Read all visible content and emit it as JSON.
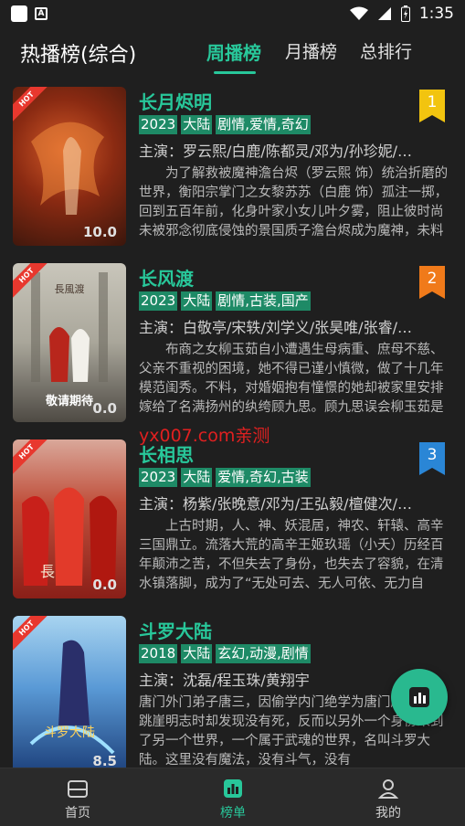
{
  "status_bar": {
    "time": "1:35"
  },
  "header": {
    "title": "热播榜(综合)",
    "tabs": [
      "周播榜",
      "月播榜",
      "总排行"
    ],
    "active_tab": "周播榜"
  },
  "hot_label": "HOT",
  "items": [
    {
      "title": "长月烬明",
      "tags": [
        "2023",
        "大陆",
        "剧情,爱情,奇幻"
      ],
      "cast": "主演：罗云熙/白鹿/陈都灵/邓为/孙珍妮/…",
      "description": "为了解救被魔神澹台烬（罗云熙 饰）统治折磨的世界，衡阳宗掌门之女黎苏苏（白鹿 饰）孤注一掷，回到五百年前，化身叶家小女儿叶夕雾，阻止彼时尚未被邪念彻底侵蚀的景国质子澹台烬成为魔神，未料澹台烬竟是叶夕雾的丈夫",
      "score": "10.0",
      "rank": "1",
      "rank_color": "#f2c40f"
    },
    {
      "title": "长风渡",
      "tags": [
        "2023",
        "大陆",
        "剧情,古装,国产"
      ],
      "cast": "主演：白敬亭/宋轶/刘学义/张昊唯/张睿/…",
      "description": "布商之女柳玉茹自小遭遇生母病重、庶母不慈、父亲不重视的困境，她不得已谨小慎微，做了十几年模范闺秀。不料，对婚姻抱有憧憬的她却被家里安排嫁给了名满扬州的纨绔顾九思。顾九思误会柳玉茹是为了攀附权贵才嫁给他，对其",
      "score": "0.0",
      "poster_text": "敬请期待",
      "rank": "2",
      "rank_color": "#f07a1a"
    },
    {
      "title": "长相思",
      "tags": [
        "2023",
        "大陆",
        "爱情,奇幻,古装"
      ],
      "cast": "主演：杨紫/张晚意/邓为/王弘毅/檀健次/…",
      "description": "上古时期，人、神、妖混居，神农、轩辕、高辛三国鼎立。流落大荒的高辛王姬玖瑶（小夭）历经百年颠沛之苦，不但失去了身份，也失去了容貌，在清水镇落脚，成为了“无处可去、无人可依、无力自保”的玟小六。他是毒为生姿意",
      "score": "0.0",
      "rank": "3",
      "rank_color": "#2a86d6"
    },
    {
      "title": "斗罗大陆",
      "tags": [
        "2018",
        "大陆",
        "玄幻,动漫,剧情"
      ],
      "cast": "主演：沈磊/程玉珠/黄翔宇",
      "description": "唐门外门弟子唐三，因偷学内门绝学为唐门所不容，跳崖明志时却发现没有死，反而以另外一个身份来到了另一个世界，一个属于武魂的世界，名叫斗罗大陆。这里没有魔法，没有斗气，没有",
      "score": "8.5"
    }
  ],
  "watermark": "yx007.com亲测",
  "bottom_nav": [
    {
      "label": "首页",
      "icon": "home-icon"
    },
    {
      "label": "榜单",
      "icon": "chart-icon"
    },
    {
      "label": "我的",
      "icon": "user-icon"
    }
  ],
  "colors": {
    "accent": "#28c79a",
    "tag_bg": "#1e8a66",
    "background": "#1f1f1f",
    "hot": "#e8382e"
  }
}
